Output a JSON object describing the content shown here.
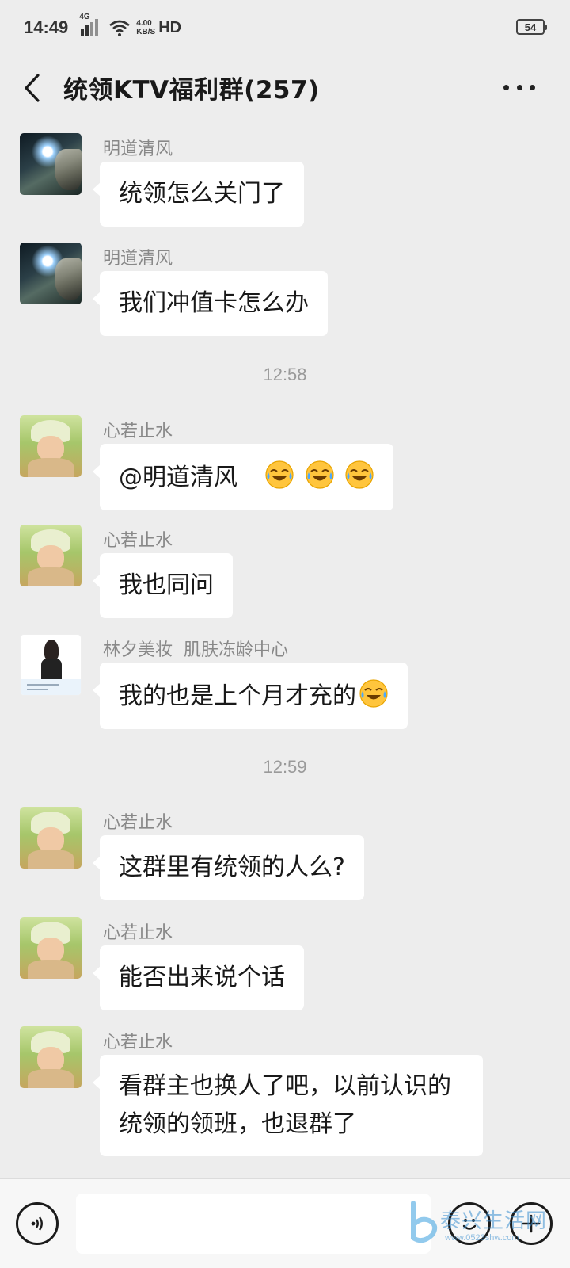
{
  "status_bar": {
    "time": "14:49",
    "network": "4G",
    "speed_value": "4.00",
    "speed_unit": "KB/S",
    "hd": "HD",
    "battery": "54"
  },
  "header": {
    "title": "统领KTV福利群(257)"
  },
  "messages": [
    {
      "sender": "明道清风",
      "text": "统领怎么关门了",
      "avatar": "space-avatar"
    },
    {
      "sender": "明道清风",
      "text": "我们冲值卡怎么办",
      "avatar": "space-avatar"
    },
    {
      "time": "12:58"
    },
    {
      "sender": "心若止水",
      "text": "@明道清风",
      "emoji": [
        "crying-laughing-icon",
        "crying-laughing-icon",
        "crying-laughing-icon"
      ],
      "avatar": "child-avatar"
    },
    {
      "sender": "心若止水",
      "text": "我也同问",
      "avatar": "child-avatar"
    },
    {
      "sender": "林夕美妆  肌肤冻龄中心",
      "text": "我的也是上个月才充的",
      "emoji": [
        "crying-laughing-icon"
      ],
      "avatar": "woman-avatar"
    },
    {
      "time": "12:59"
    },
    {
      "sender": "心若止水",
      "text": "这群里有统领的人么?",
      "avatar": "child-avatar"
    },
    {
      "sender": "心若止水",
      "text": "能否出来说个话",
      "avatar": "child-avatar"
    },
    {
      "sender": "心若止水",
      "text": "看群主也换人了吧，以前认识的统领的领班，也退群了",
      "avatar": "child-avatar"
    }
  ],
  "input_bar": {
    "input_value": "",
    "icons": [
      "voice-icon",
      "emoji-icon",
      "add-icon"
    ]
  },
  "watermark": {
    "text": "泰兴生活网",
    "url": "www.0523shw.com"
  },
  "colors": {
    "background": "#ededed",
    "bubble": "#ffffff",
    "sender_name": "#888888",
    "timestamp": "#9a9a9a"
  }
}
